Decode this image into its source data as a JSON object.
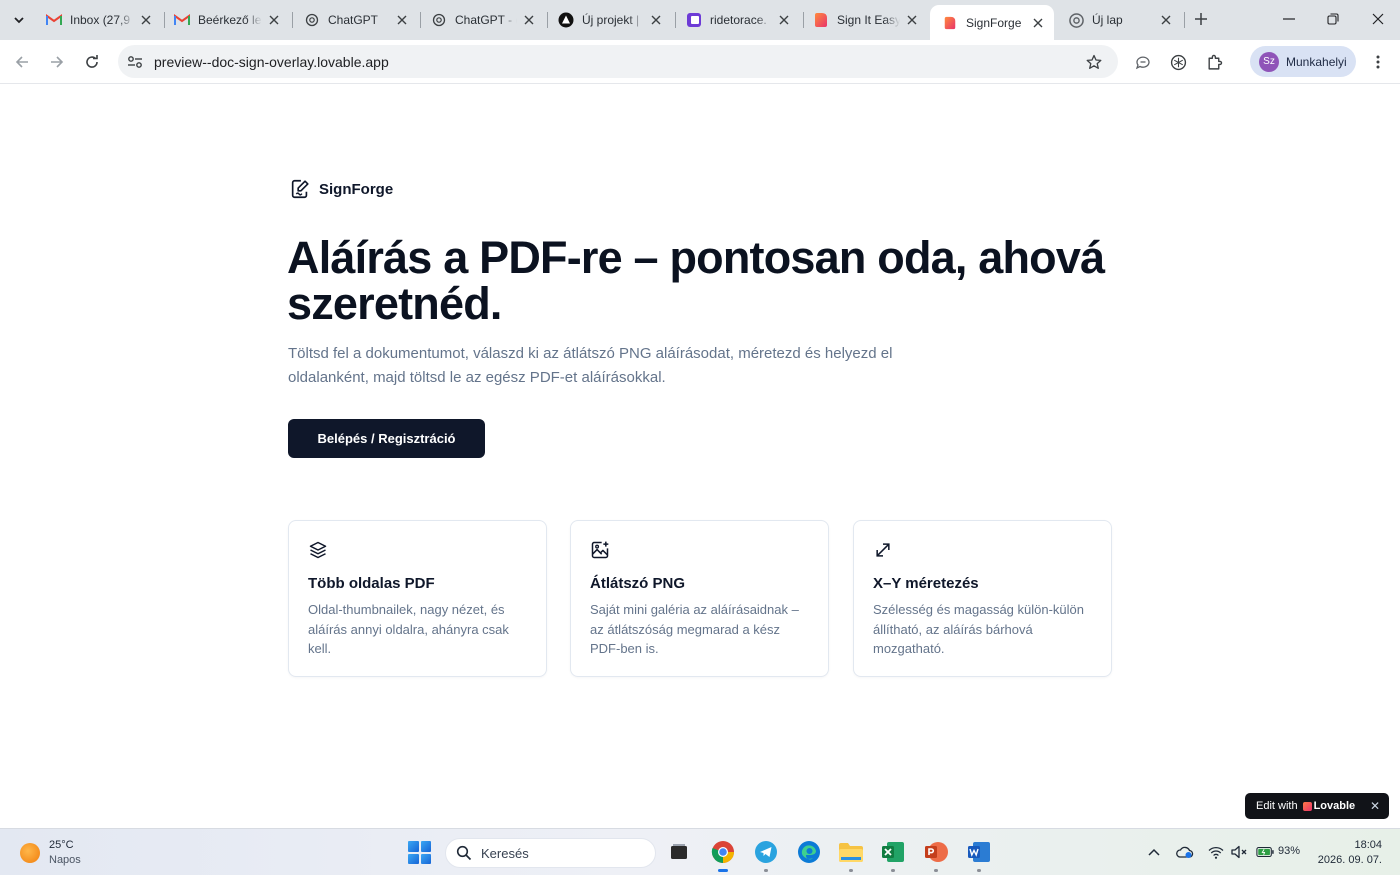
{
  "browser": {
    "tabs": [
      {
        "title": "Inbox (27,9",
        "icon": "gmail-icon"
      },
      {
        "title": "Beérkező le",
        "icon": "gmail-icon"
      },
      {
        "title": "ChatGPT",
        "icon": "chatgpt-icon"
      },
      {
        "title": "ChatGPT - (",
        "icon": "chatgpt-icon"
      },
      {
        "title": "Új projekt |",
        "icon": "project-icon"
      },
      {
        "title": "ridetorace.",
        "icon": "ridetorace-icon"
      },
      {
        "title": "Sign It Easy",
        "icon": "lovable-icon"
      },
      {
        "title": "SignForge",
        "icon": "lovable-icon",
        "active": true
      },
      {
        "title": "Új lap",
        "icon": "chrome-icon"
      }
    ],
    "url": "preview--doc-sign-overlay.lovable.app",
    "profile_initials": "Sz",
    "profile_name": "Munkahelyi"
  },
  "page": {
    "brand": "SignForge",
    "headline": "Aláírás a PDF-re – pontosan oda, ahová szeretnéd.",
    "lead": "Töltsd fel a dokumentumot, válaszd ki az átlátszó PNG aláírásodat, méretezd és helyezd el oldalanként, majd töltsd le az egész PDF-et aláírásokkal.",
    "cta_label": "Belépés / Regisztráció",
    "features": [
      {
        "icon": "layers-icon",
        "title": "Több oldalas PDF",
        "desc": "Oldal-thumbnailek, nagy nézet, és aláírás annyi oldalra, ahányra csak kell."
      },
      {
        "icon": "image-plus-icon",
        "title": "Átlátszó PNG",
        "desc": "Saját mini galéria az aláírásaidnak – az átlátszóság megmarad a kész PDF-ben is."
      },
      {
        "icon": "resize-arrows-icon",
        "title": "X–Y méretezés",
        "desc": "Szélesség és magasság külön-külön állítható, az aláírás bárhová mozgatható."
      }
    ],
    "lovable_badge": {
      "prefix": "Edit with",
      "brand": "Lovable"
    }
  },
  "taskbar": {
    "weather_temp": "25°C",
    "weather_desc": "Napos",
    "search_placeholder": "Keresés",
    "battery": "93%",
    "time": "18:04",
    "date": "2026. 09. 07."
  }
}
